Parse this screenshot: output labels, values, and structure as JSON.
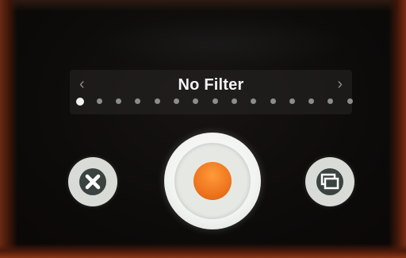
{
  "filter_selector": {
    "current_filter": "No Filter",
    "prev_glyph": "‹",
    "next_glyph": "›",
    "filter_count": 15,
    "active_index": 0
  },
  "controls": {
    "cancel_icon": "close-icon",
    "shutter_icon": "record-icon",
    "switch_icon": "switch-camera-icon"
  },
  "colors": {
    "record_accent": "#f07820",
    "button_face": "#d9dcd6",
    "button_inner": "#3b4340",
    "dot_inactive": "#8c8c8c",
    "dot_active": "#f2f2f2"
  }
}
